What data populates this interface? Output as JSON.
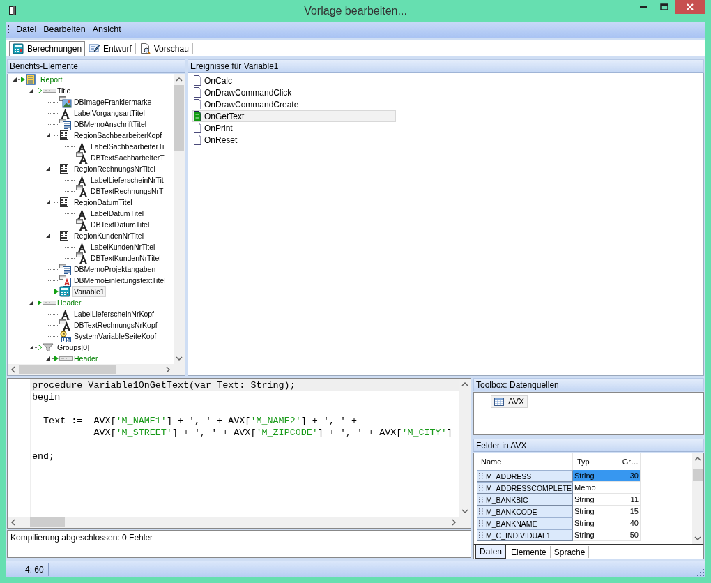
{
  "window": {
    "title": "Vorlage bearbeiten..."
  },
  "menu": [
    {
      "label": "Datei"
    },
    {
      "label": "Bearbeiten"
    },
    {
      "label": "Ansicht"
    }
  ],
  "view_tabs": [
    {
      "label": "Berechnungen",
      "kind": "calculator",
      "selected": true
    },
    {
      "label": "Entwurf",
      "kind": "design",
      "selected": false
    },
    {
      "label": "Vorschau",
      "kind": "preview",
      "selected": false
    }
  ],
  "report_tree": {
    "title": "Berichts-Elemente",
    "items": [
      {
        "label": "Report",
        "kind": "report",
        "expanded": true,
        "has_code": true,
        "active": true,
        "selected": false,
        "children": [
          {
            "label": "Title",
            "kind": "band",
            "expanded": true,
            "has_code": false,
            "active": false,
            "selected": false,
            "children": [
              {
                "label": "DBImageFrankiermarke",
                "kind": "dbimage",
                "active": false,
                "selected": false
              },
              {
                "label": "LabelVorgangsartTitel",
                "kind": "label",
                "active": false,
                "selected": false
              },
              {
                "label": "DBMemoAnschriftTitel",
                "kind": "dbmemo",
                "active": false,
                "selected": false
              },
              {
                "label": "RegionSachbearbeiterKopf",
                "kind": "region",
                "expanded": true,
                "active": false,
                "selected": false,
                "children": [
                  {
                    "label": "LabelSachbearbeiterTi",
                    "kind": "label",
                    "active": false,
                    "selected": false
                  },
                  {
                    "label": "DBTextSachbarbeiterT",
                    "kind": "dbtext",
                    "active": false,
                    "selected": false
                  }
                ]
              },
              {
                "label": "RegionRechnungsNrTitel",
                "kind": "region",
                "expanded": true,
                "active": false,
                "selected": false,
                "children": [
                  {
                    "label": "LabelLieferscheinNrTit",
                    "kind": "label",
                    "active": false,
                    "selected": false
                  },
                  {
                    "label": "DBTextRechnungsNrT",
                    "kind": "dbtext",
                    "active": false,
                    "selected": false
                  }
                ]
              },
              {
                "label": "RegionDatumTitel",
                "kind": "region",
                "expanded": true,
                "active": false,
                "selected": false,
                "children": [
                  {
                    "label": "LabelDatumTitel",
                    "kind": "label",
                    "active": false,
                    "selected": false
                  },
                  {
                    "label": "DBTextDatumTitel",
                    "kind": "dbtext",
                    "active": false,
                    "selected": false
                  }
                ]
              },
              {
                "label": "RegionKundenNrTitel",
                "kind": "region",
                "expanded": true,
                "active": false,
                "selected": false,
                "children": [
                  {
                    "label": "LabelKundenNrTitel",
                    "kind": "label",
                    "active": false,
                    "selected": false
                  },
                  {
                    "label": "DBTextKundenNrTitel",
                    "kind": "dbtext",
                    "active": false,
                    "selected": false
                  }
                ]
              },
              {
                "label": "DBMemoProjektangaben",
                "kind": "dbmemo",
                "active": false,
                "selected": false
              },
              {
                "label": "DBMemoEinleitungstextTitel",
                "kind": "dbrichtext",
                "active": false,
                "selected": false
              },
              {
                "label": "Variable1",
                "kind": "variable",
                "has_code": true,
                "active": false,
                "selected": true
              }
            ]
          },
          {
            "label": "Header",
            "kind": "band",
            "expanded": true,
            "has_code": true,
            "active": true,
            "selected": false,
            "children": [
              {
                "label": "LabelLieferscheinNrKopf",
                "kind": "label",
                "active": false,
                "selected": false
              },
              {
                "label": "DBTextRechnungsNrKopf",
                "kind": "dbtext",
                "active": false,
                "selected": false
              },
              {
                "label": "SystemVariableSeiteKopf",
                "kind": "sysvar",
                "active": false,
                "selected": false
              }
            ]
          },
          {
            "label": "Groups[0]",
            "kind": "groups",
            "expanded": true,
            "has_code": false,
            "active": false,
            "selected": false,
            "children": [
              {
                "label": "Header",
                "kind": "band",
                "expanded": true,
                "has_code": true,
                "active": true,
                "selected": false
              }
            ]
          }
        ]
      }
    ]
  },
  "events": {
    "title": "Ereignisse für Variable1",
    "items": [
      {
        "label": "OnCalc",
        "has_code": false,
        "selected": false
      },
      {
        "label": "OnDrawCommandClick",
        "has_code": false,
        "selected": false
      },
      {
        "label": "OnDrawCommandCreate",
        "has_code": false,
        "selected": false
      },
      {
        "label": "OnGetText",
        "has_code": true,
        "selected": true
      },
      {
        "label": "OnPrint",
        "has_code": false,
        "selected": false
      },
      {
        "label": "OnReset",
        "has_code": false,
        "selected": false
      }
    ]
  },
  "code_editor": {
    "lines": [
      {
        "current": true,
        "tokens": [
          {
            "kind": "plain",
            "text": "procedure Variable1OnGetText(var Text: String);"
          }
        ]
      },
      {
        "current": false,
        "tokens": [
          {
            "kind": "plain",
            "text": "begin"
          }
        ]
      },
      {
        "current": false
      },
      {
        "current": false,
        "tokens": [
          {
            "kind": "plain",
            "text": "  Text :=  AVX["
          },
          {
            "kind": "string",
            "text": "'M_NAME1'"
          },
          {
            "kind": "plain",
            "text": "] + ', ' + AVX["
          },
          {
            "kind": "string",
            "text": "'M_NAME2'"
          },
          {
            "kind": "plain",
            "text": "] + ', ' +"
          }
        ]
      },
      {
        "current": false,
        "tokens": [
          {
            "kind": "plain",
            "text": "           AVX["
          },
          {
            "kind": "string",
            "text": "'M_STREET'"
          },
          {
            "kind": "plain",
            "text": "] + ', ' + AVX["
          },
          {
            "kind": "string",
            "text": "'M_ZIPCODE'"
          },
          {
            "kind": "plain",
            "text": "] + ', ' + AVX["
          },
          {
            "kind": "string",
            "text": "'M_CITY'"
          },
          {
            "kind": "plain",
            "text": "]"
          }
        ]
      },
      {
        "current": false
      },
      {
        "current": false,
        "tokens": [
          {
            "kind": "plain",
            "text": "end;"
          }
        ]
      }
    ]
  },
  "messages": {
    "text": "Kompilierung abgeschlossen: 0 Fehler"
  },
  "toolbox": {
    "title": "Toolbox: Datenquellen",
    "items": [
      {
        "label": "AVX",
        "selected": true
      }
    ]
  },
  "fields": {
    "title": "Felder in AVX",
    "columns": [
      "Name",
      "Typ",
      "Gr…"
    ],
    "rows": [
      {
        "name": "M_ADDRESS",
        "type": "String",
        "size": "30",
        "selected": true
      },
      {
        "name": "M_ADDRESSCOMPLETE",
        "type": "Memo",
        "selected": false
      },
      {
        "name": "M_BANKBIC",
        "type": "String",
        "size": "11",
        "selected": false
      },
      {
        "name": "M_BANKCODE",
        "type": "String",
        "size": "15",
        "selected": false
      },
      {
        "name": "M_BANKNAME",
        "type": "String",
        "size": "40",
        "selected": false
      },
      {
        "name": "M_C_INDIVIDUAL1",
        "type": "String",
        "size": "50",
        "selected": false
      }
    ]
  },
  "bottom_tabs": [
    {
      "label": "Daten",
      "selected": true
    },
    {
      "label": "Elemente",
      "selected": false
    },
    {
      "label": "Sprache",
      "selected": false
    }
  ],
  "status_bar": {
    "position": "4: 60"
  }
}
